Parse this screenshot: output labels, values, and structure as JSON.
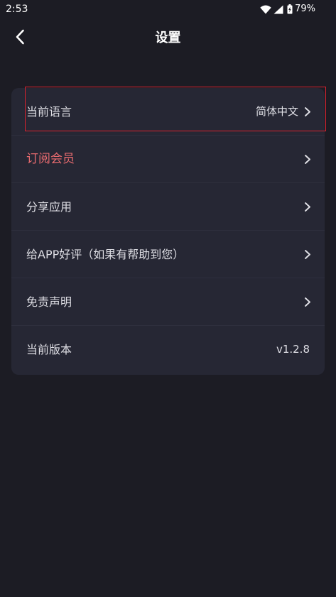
{
  "status_bar": {
    "time": "2:53",
    "battery_percent": "79%",
    "icons": [
      "wifi-icon",
      "signal-icon",
      "battery-charging-icon"
    ]
  },
  "header": {
    "title": "设置",
    "back_icon": "chevron-left-icon"
  },
  "settings": {
    "rows": [
      {
        "label": "当前语言",
        "value": "简体中文",
        "chevron": true
      },
      {
        "label": "订阅会员",
        "value": "",
        "chevron": true,
        "accent": "#e86b6f"
      },
      {
        "label": "分享应用",
        "value": "",
        "chevron": true
      },
      {
        "label": "给APP好评（如果有帮助到您）",
        "value": "",
        "chevron": true
      },
      {
        "label": "免责声明",
        "value": "",
        "chevron": true
      },
      {
        "label": "当前版本",
        "value": "v1.2.8",
        "chevron": false
      }
    ]
  },
  "colors": {
    "background": "#1c1c24",
    "card": "#262734",
    "text": "#dedee4",
    "accent": "#e86b6f",
    "selection": "#d9222e"
  }
}
